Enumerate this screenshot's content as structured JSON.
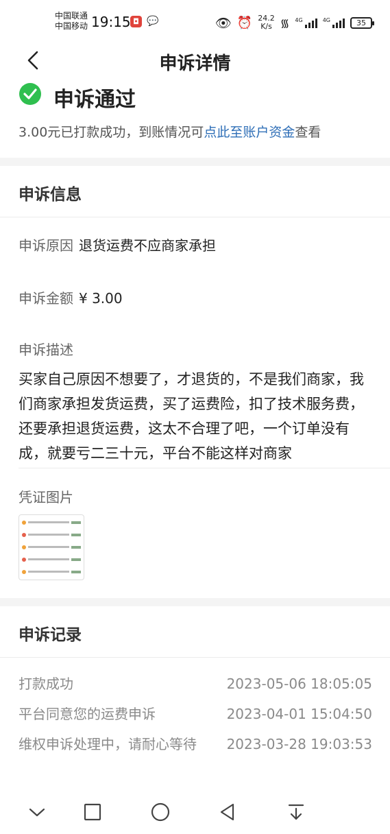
{
  "status_bar": {
    "carrier_1": "中国联通",
    "carrier_2": "中国移动",
    "time": "19:15",
    "speed_value": "24.2",
    "speed_unit": "K/s",
    "network_1": "4G",
    "network_2": "4G",
    "battery": "35",
    "icons": [
      "app-notification-icon",
      "wechat-icon",
      "eye-icon",
      "alarm-icon",
      "wifi-icon",
      "signal-icon",
      "battery-icon"
    ]
  },
  "navbar": {
    "title": "申诉详情"
  },
  "status_card": {
    "title": "申诉通过",
    "message_prefix": "3.00元已打款成功，到账情况可",
    "message_link": "点此至账户资金",
    "message_suffix": "查看",
    "accent_color": "#2fbf4f",
    "link_color": "#2f6fb7"
  },
  "info": {
    "section_title": "申诉信息",
    "reason_label": "申诉原因",
    "reason_value": "退货运费不应商家承担",
    "amount_label": "申诉金额",
    "amount_value": "¥ 3.00",
    "description_label": "申诉描述",
    "description_text": "买家自己原因不想要了，才退货的，不是我们商家，我们商家承担发货运费，买了运费险，扣了技术服务费，还要承担退货运费，这太不合理了吧，一个订单没有成，就要亏二三十元，平台不能这样对商家",
    "evidence_label": "凭证图片"
  },
  "records": {
    "section_title": "申诉记录",
    "items": [
      {
        "label": "打款成功",
        "time": "2023-05-06 18:05:05"
      },
      {
        "label": "平台同意您的运费申诉",
        "time": "2023-04-01 15:04:50"
      },
      {
        "label": "维权申诉处理中，请耐心等待",
        "time": "2023-03-28 19:03:53"
      }
    ]
  },
  "system_nav": {
    "icons": [
      "chevron-down-icon",
      "square-icon",
      "circle-icon",
      "triangle-back-icon",
      "download-arrow-icon"
    ]
  }
}
